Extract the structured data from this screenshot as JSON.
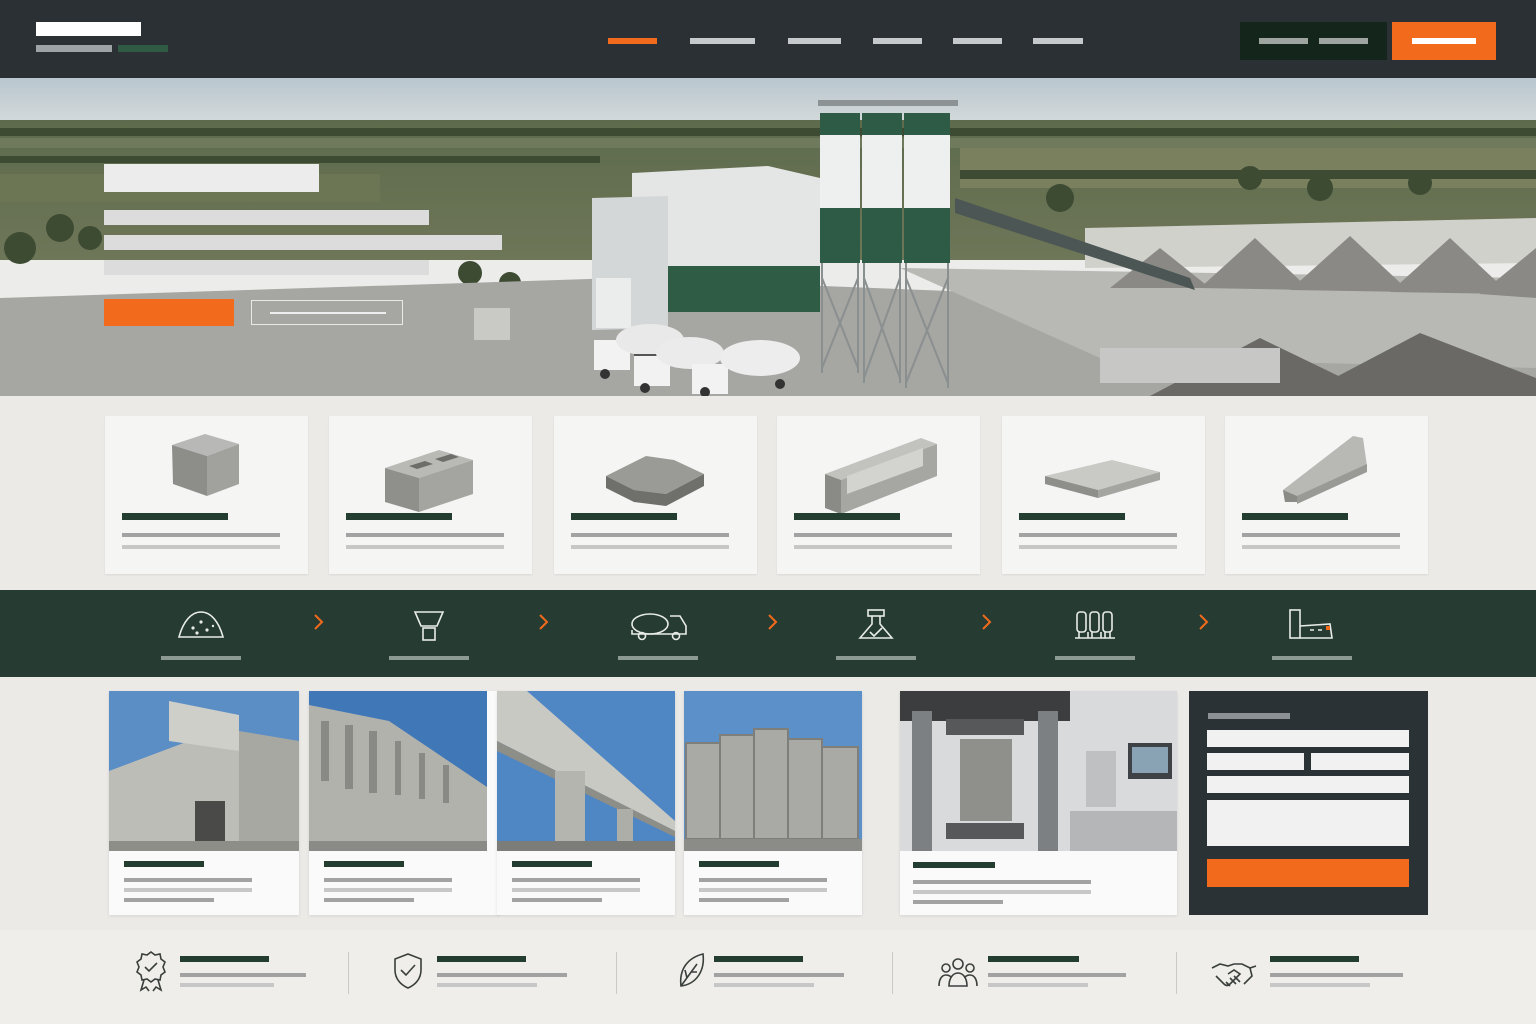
{
  "colors": {
    "header_bg": "#2a3034",
    "accent_orange": "#f26a1c",
    "brand_green": "#233d31",
    "process_bg": "#263b31",
    "form_bg": "#2b3236"
  },
  "nav": {
    "items": [
      {
        "id": "nav-1",
        "active": true
      },
      {
        "id": "nav-2",
        "active": false
      },
      {
        "id": "nav-3",
        "active": false
      },
      {
        "id": "nav-4",
        "active": false
      },
      {
        "id": "nav-5",
        "active": false
      },
      {
        "id": "nav-6",
        "active": false
      }
    ]
  },
  "hero": {
    "image": "concrete-batching-plant-photo"
  },
  "products": [
    {
      "icon": "concrete-cube-icon"
    },
    {
      "icon": "hollow-block-icon"
    },
    {
      "icon": "paver-icon"
    },
    {
      "icon": "u-channel-icon"
    },
    {
      "icon": "slab-icon"
    },
    {
      "icon": "barrier-icon"
    }
  ],
  "process": [
    {
      "icon": "aggregate-pile-icon"
    },
    {
      "icon": "hopper-icon"
    },
    {
      "icon": "mixer-truck-icon"
    },
    {
      "icon": "quality-lab-icon"
    },
    {
      "icon": "silos-icon"
    },
    {
      "icon": "plant-icon"
    }
  ],
  "projects": [
    {
      "image": "concrete-building-photo"
    },
    {
      "image": "concrete-facade-photo"
    },
    {
      "image": "overpass-bridge-photo"
    },
    {
      "image": "concrete-wall-panels-photo"
    },
    {
      "image": "compression-test-photo"
    }
  ],
  "features": [
    {
      "icon": "certified-badge-icon"
    },
    {
      "icon": "shield-check-icon"
    },
    {
      "icon": "leaf-icon"
    },
    {
      "icon": "team-icon"
    },
    {
      "icon": "handshake-icon"
    }
  ]
}
